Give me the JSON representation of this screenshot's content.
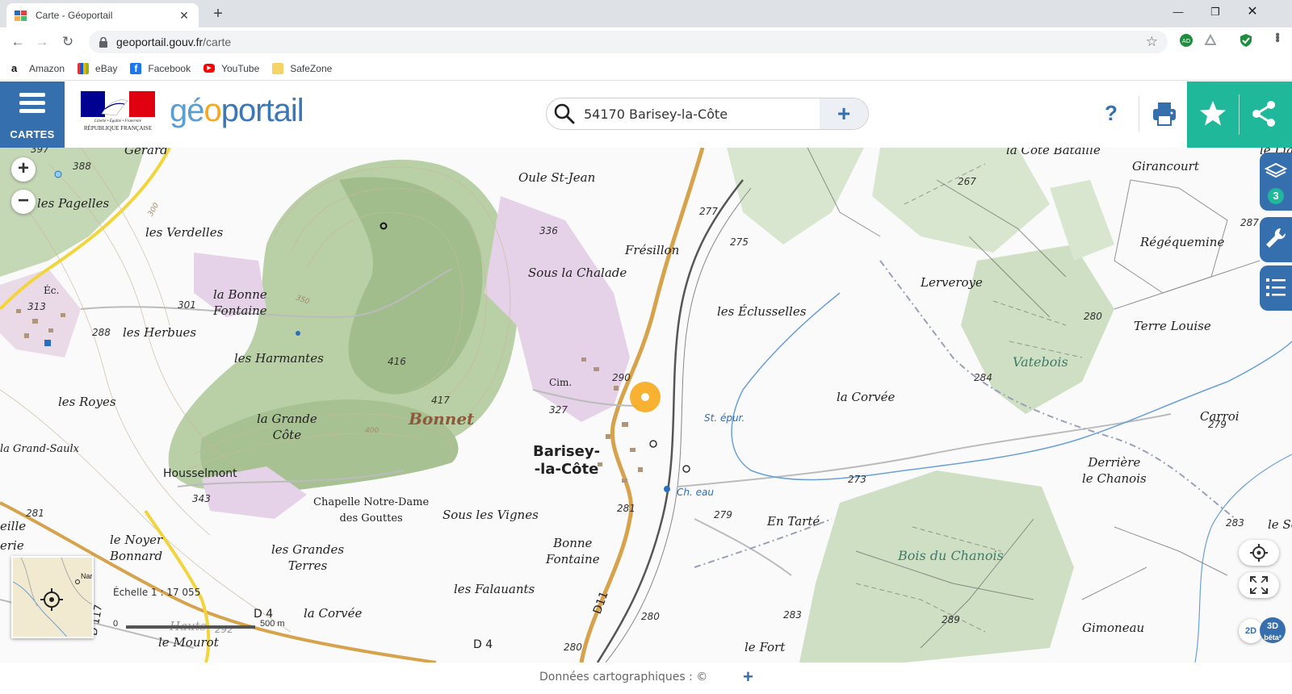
{
  "browser": {
    "tab_title": "Carte - Géoportail",
    "url_host": "geoportail.gouv.fr",
    "url_path": "/carte",
    "bookmarks": [
      "Amazon",
      "eBay",
      "Facebook",
      "YouTube",
      "SafeZone"
    ]
  },
  "header": {
    "menu_label": "CARTES",
    "brand_g": "g",
    "brand_e": "é",
    "brand_o": "o",
    "brand_rest": "portail",
    "rf_caption_1": "Liberté • Égalité • Fraternité",
    "rf_caption_2": "RÉPUBLIQUE FRANÇAISE",
    "search_value": "54170 Barisey-la-Côte",
    "help_label": "?"
  },
  "map": {
    "layer_count": "3",
    "scale_label": "Échelle 1 : 17 055",
    "scale_zero": "0",
    "scale_max": "500 m",
    "toggle_2d": "2D",
    "toggle_3d": "3D",
    "toggle_beta": "bêta²",
    "overview_label": "Nar",
    "labels": {
      "gerard": "Gérard",
      "pagelles": "les Pagelles",
      "verdelles": "les Verdelles",
      "bonne_fontaine_w": "la Bonne\nFontaine",
      "herbues": "les Herbues",
      "harmantes": "les Harmantes",
      "royes": "les Royes",
      "grand_saulx": "la Grand-Saulx",
      "grande_cote": "la Grande\nCôte",
      "bonnet": "Bonnet",
      "housselmont": "Housselmont",
      "chapelle": "Chapelle Notre-Dame\ndes Gouttes",
      "noyer": "le Noyer\nBonnard",
      "grandes_terres": "les Grandes\nTerres",
      "corvee_s": "la Corvée",
      "mourot": "le Mourot",
      "hauts": "Hauts",
      "oule": "Oule St-Jean",
      "fresillon": "Frésillon",
      "sous_chalade": "Sous la Chalade",
      "barisey": "Barisey-\n-la-Côte",
      "sous_vignes": "Sous les Vignes",
      "bonne_fontaine_s": "Bonne\nFontaine",
      "falauants": "les Falauants",
      "cim": "Cim.",
      "ecluselles": "les Éclusselles",
      "lerveroye": "Lerveroye",
      "corvee_e": "la Corvée",
      "en_tarte": "En Tarté",
      "bois_chanois": "Bois du Chanois",
      "cote_bataille": "la Côte Bataille",
      "girancourt": "Girancourt",
      "regequemine": "Régéquemine",
      "terre_louise": "Terre Louise",
      "vatebois": "Vatebois",
      "carroi": "Carroi",
      "derriere": "Derrière\nle Chanois",
      "gimoneau": "Gimoneau",
      "le_fort": "le Fort",
      "la_lia": "le Lia",
      "le_so": "le So",
      "eille": "eille",
      "erie": "erie",
      "ec": "Éc.",
      "st_epur": "St. épur.",
      "ch_eau": "Ch. eau",
      "d11": "D11",
      "d4a": "D 4",
      "d4b": "D 4",
      "d117": "D 117"
    },
    "altitudes": [
      "397",
      "388",
      "313",
      "288",
      "301",
      "416",
      "417",
      "327",
      "290",
      "343",
      "281",
      "277",
      "275",
      "336",
      "267",
      "287",
      "280",
      "284",
      "279",
      "273",
      "279",
      "283",
      "283",
      "289",
      "280",
      "281",
      "292",
      "280",
      "300",
      "350",
      "400"
    ]
  },
  "footer": {
    "text": "Données cartographiques : ©",
    "plus": "+"
  }
}
